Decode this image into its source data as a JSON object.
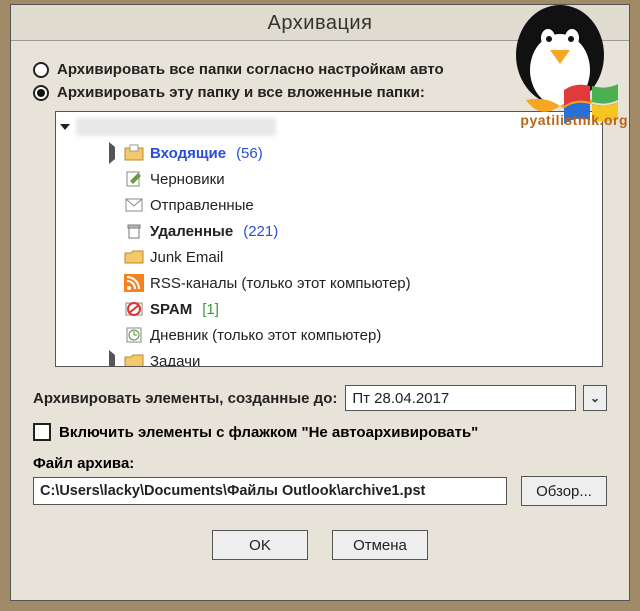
{
  "window": {
    "title": "Архивация"
  },
  "radios": {
    "all": "Архивировать все папки согласно настройкам авто",
    "this": "Архивировать эту папку и все вложенные папки:",
    "selected": "this"
  },
  "tree": {
    "items": [
      {
        "expander": "▷",
        "icon": "inbox",
        "label": "Входящие",
        "count": "(56)",
        "bold": true,
        "selected": true,
        "countColor": "blue"
      },
      {
        "expander": "",
        "icon": "draft",
        "label": "Черновики",
        "count": "",
        "bold": false,
        "selected": false
      },
      {
        "expander": "",
        "icon": "sent",
        "label": "Отправленные",
        "count": "",
        "bold": false,
        "selected": false
      },
      {
        "expander": "",
        "icon": "trash",
        "label": "Удаленные",
        "count": "(221)",
        "bold": true,
        "selected": false,
        "countColor": "blue"
      },
      {
        "expander": "",
        "icon": "folder",
        "label": "Junk Email",
        "count": "",
        "bold": false,
        "selected": false
      },
      {
        "expander": "",
        "icon": "rss",
        "label": "RSS-каналы (только этот компьютер)",
        "count": "",
        "bold": false,
        "selected": false
      },
      {
        "expander": "",
        "icon": "spam",
        "label": "SPAM",
        "count": "[1]",
        "bold": true,
        "selected": false,
        "countColor": "green"
      },
      {
        "expander": "",
        "icon": "journal",
        "label": "Дневник (только этот компьютер)",
        "count": "",
        "bold": false,
        "selected": false
      },
      {
        "expander": "▷",
        "icon": "folder",
        "label": "Задачи",
        "count": "",
        "bold": false,
        "selected": false
      }
    ]
  },
  "date": {
    "label": "Архивировать элементы, созданные до:",
    "value": "Пт 28.04.2017"
  },
  "checkbox": {
    "label": "Включить элементы с флажком \"Не автоархивировать\"",
    "checked": false
  },
  "file": {
    "label": "Файл архива:",
    "value": "C:\\Users\\lacky\\Documents\\Файлы Outlook\\archive1.pst",
    "browse": "Обзор..."
  },
  "buttons": {
    "ok": "OK",
    "cancel": "Отмена"
  },
  "watermark": "pyatilistnik.org"
}
